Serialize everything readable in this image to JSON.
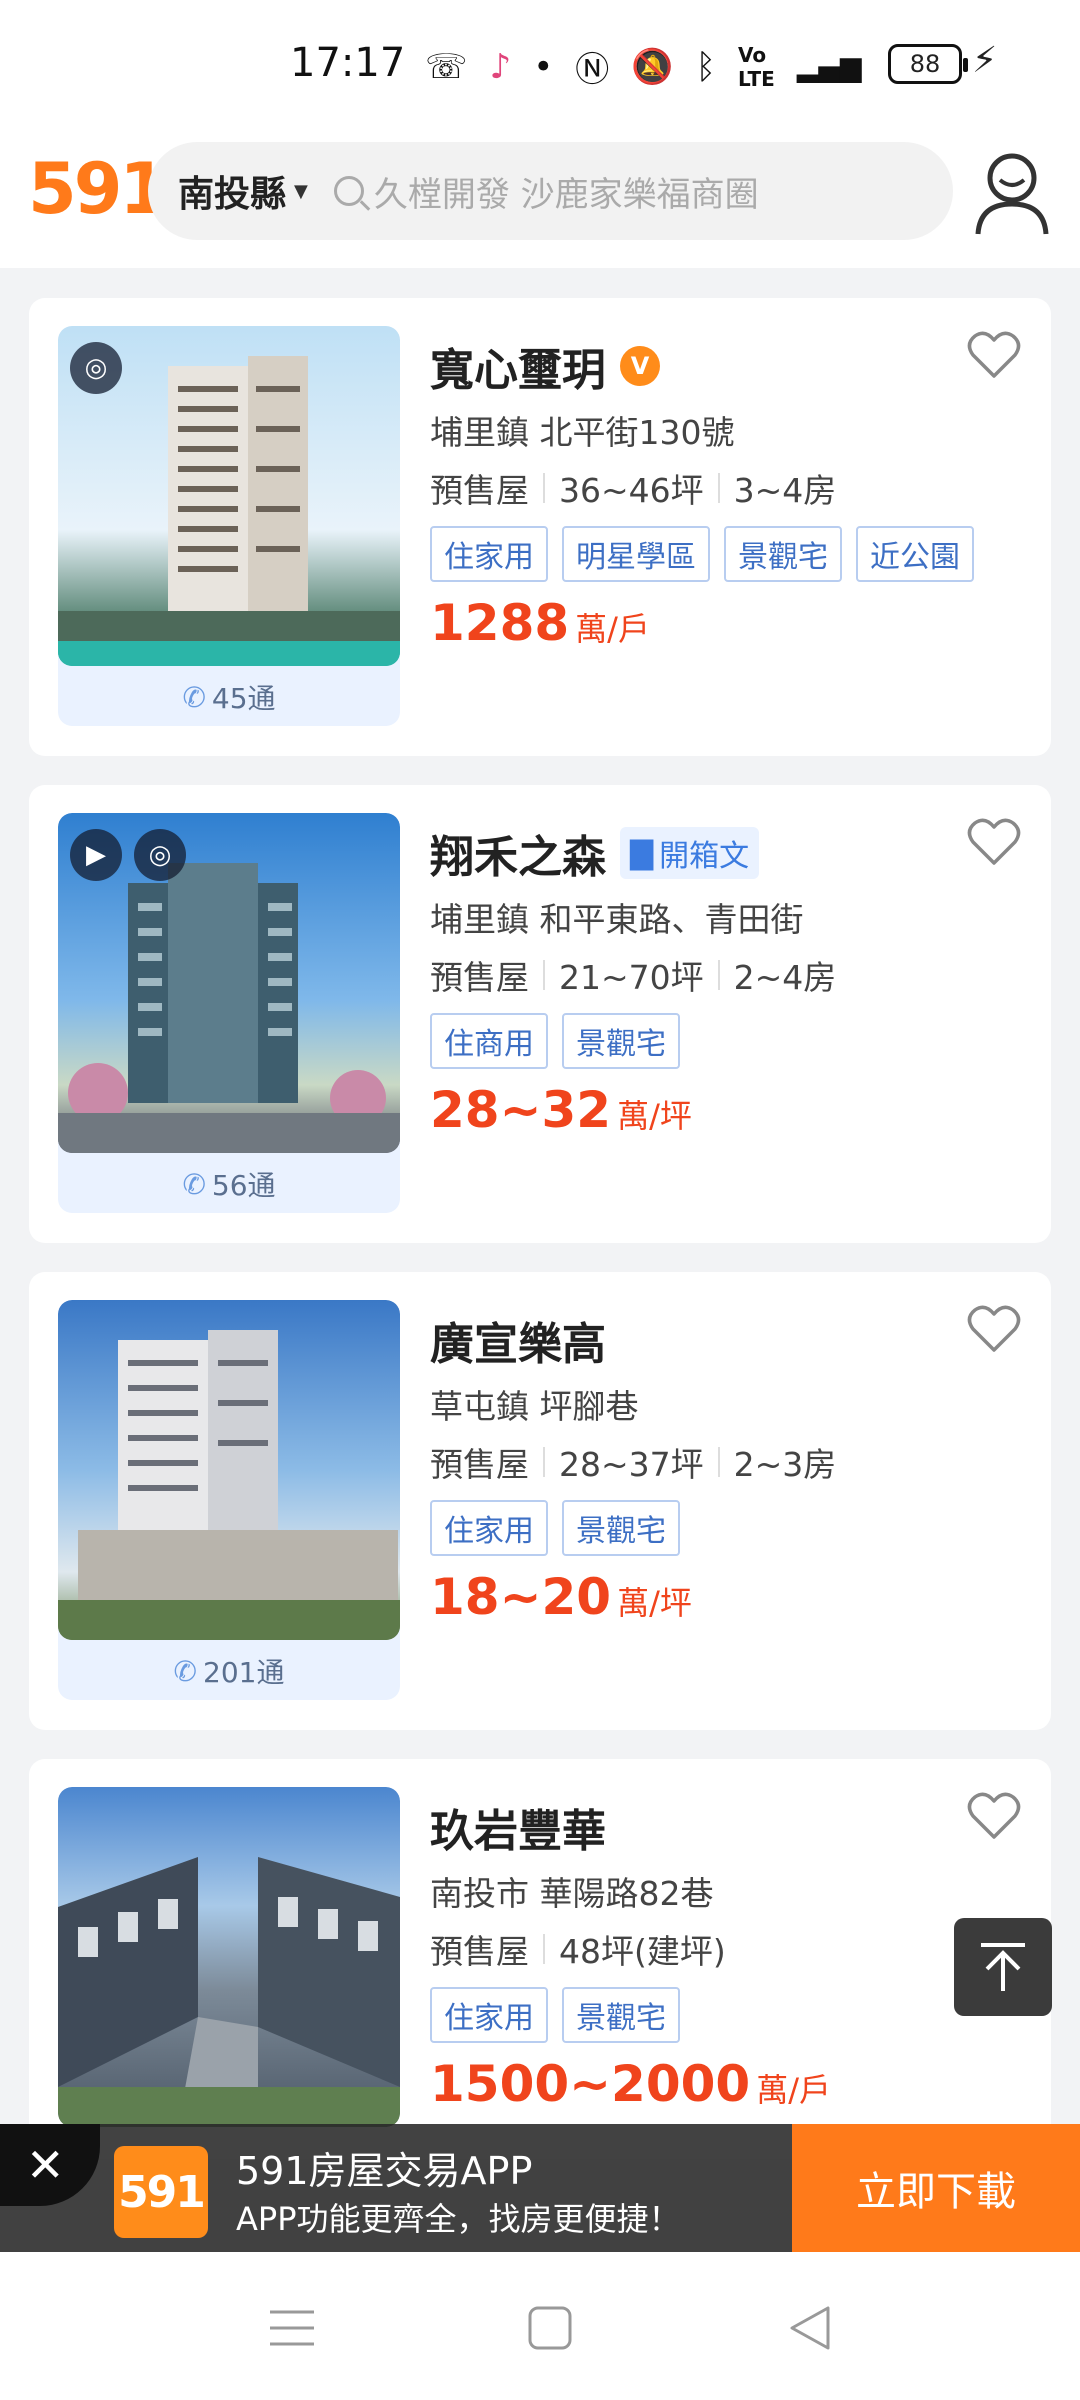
{
  "status_bar": {
    "time": "17:17",
    "battery": "88"
  },
  "header": {
    "logo": "591",
    "region": "南投縣",
    "search_placeholder": "久樘開發 沙鹿家樂福商圈"
  },
  "listings": [
    {
      "title": "寬心璽玥",
      "address": "埔里鎮 北平街130號",
      "type": "預售屋",
      "size": "36~46坪",
      "rooms": "3~4房",
      "tags": [
        "住家用",
        "明星學區",
        "景觀宅",
        "近公園"
      ],
      "price": "1288",
      "price_unit": "萬/戶",
      "calls": "45通"
    },
    {
      "title": "翔禾之森",
      "unbox_label": "開箱文",
      "address": "埔里鎮 和平東路、青田街",
      "type": "預售屋",
      "size": "21~70坪",
      "rooms": "2~4房",
      "tags": [
        "住商用",
        "景觀宅"
      ],
      "price": "28~32",
      "price_unit": "萬/坪",
      "calls": "56通"
    },
    {
      "title": "廣宣樂高",
      "address": "草屯鎮 坪腳巷",
      "type": "預售屋",
      "size": "28~37坪",
      "rooms": "2~3房",
      "tags": [
        "住家用",
        "景觀宅"
      ],
      "price": "18~20",
      "price_unit": "萬/坪",
      "calls": "201通"
    },
    {
      "title": "玖岩豐華",
      "address": "南投市 華陽路82巷",
      "type": "預售屋",
      "size": "48坪(建坪)",
      "tags": [
        "住家用",
        "景觀宅"
      ],
      "price": "1500~2000",
      "price_unit": "萬/戶"
    }
  ],
  "app_banner": {
    "logo": "591",
    "title": "591房屋交易APP",
    "subtitle": "APP功能更齊全，找房更便捷！",
    "button": "立即下載"
  },
  "colors": {
    "brand": "#ff7a1a",
    "price": "#f0441c",
    "tag_text": "#3d6fc4"
  }
}
